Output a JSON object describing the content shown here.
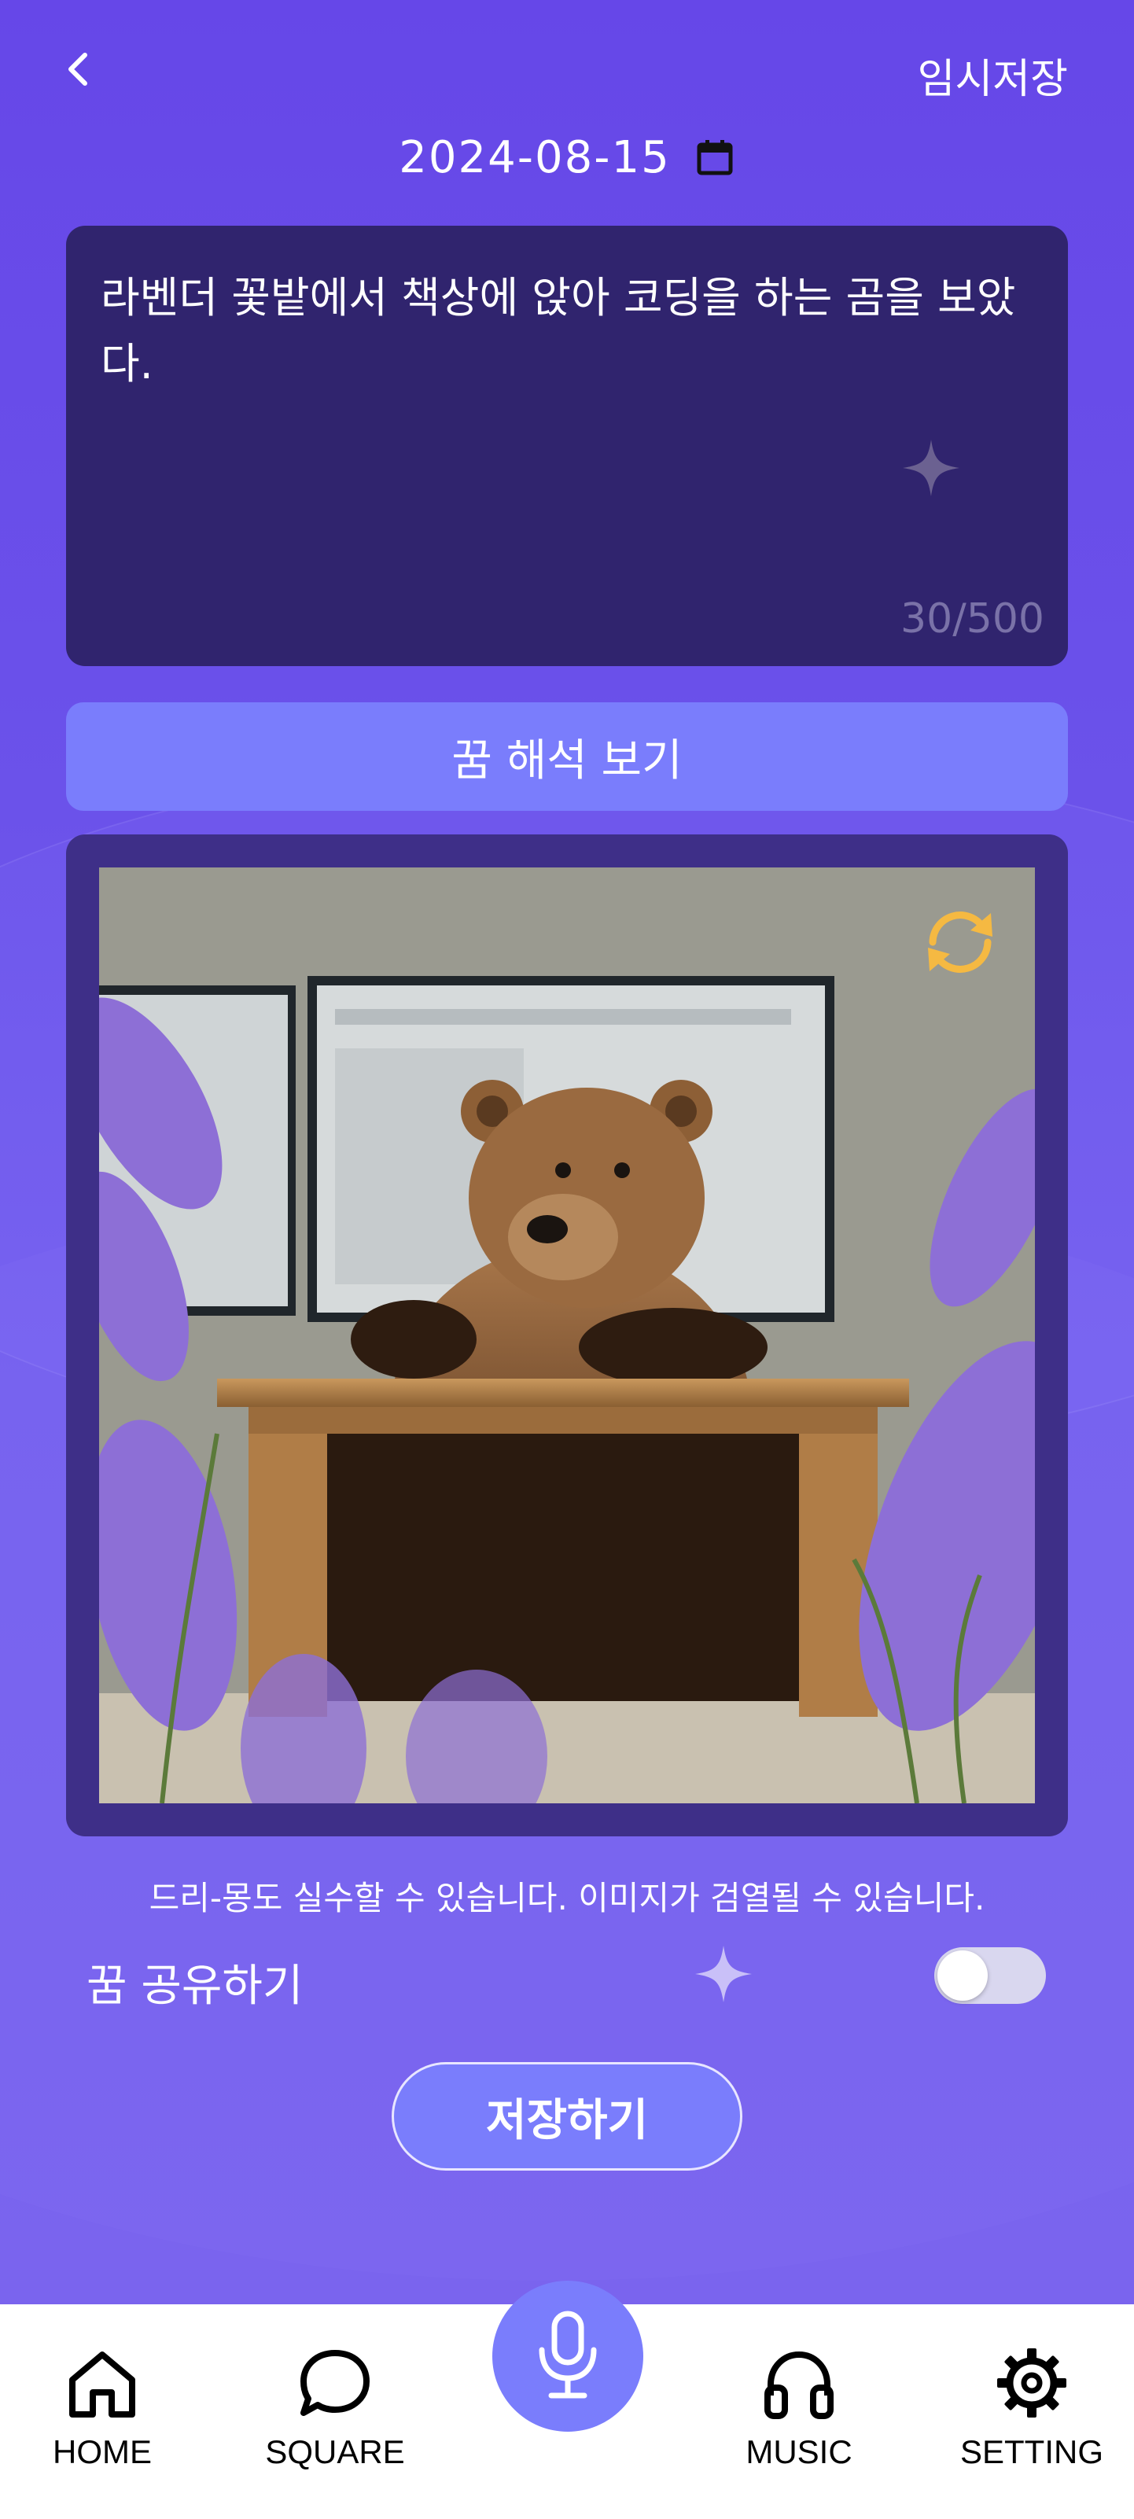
{
  "header": {
    "back_icon": "chevron-left-icon",
    "temp_save_label": "임시저장"
  },
  "date": {
    "value": "2024-08-15",
    "icon": "calendar-icon"
  },
  "dream": {
    "text": "라벤더 꽃밭에서 책상에 앉아 코딩을 하는 곰을 보았다.",
    "char_count": "30/500"
  },
  "interpret_button_label": "꿈 해석 보기",
  "image": {
    "refresh_icon": "refresh-icon",
    "refresh_color": "#f5b942"
  },
  "disclaimer": "드리-몽도 실수할 수 있습니다. 이미지가 검열될 수 있습니다.",
  "share": {
    "label": "꿈 공유하기",
    "enabled": false
  },
  "save_button_label": "저장하기",
  "nav": {
    "items": [
      {
        "label": "HOME",
        "icon": "home-icon"
      },
      {
        "label": "SQUARE",
        "icon": "chat-bubble-icon"
      },
      {
        "label": "MUSIC",
        "icon": "headphones-icon"
      },
      {
        "label": "SETTING",
        "icon": "gear-icon"
      }
    ],
    "center_icon": "microphone-icon"
  },
  "colors": {
    "background": "#6a4fe6",
    "dream_box": "#30246e",
    "accent_button": "#7a7dfc",
    "image_frame": "#3e2f88"
  }
}
